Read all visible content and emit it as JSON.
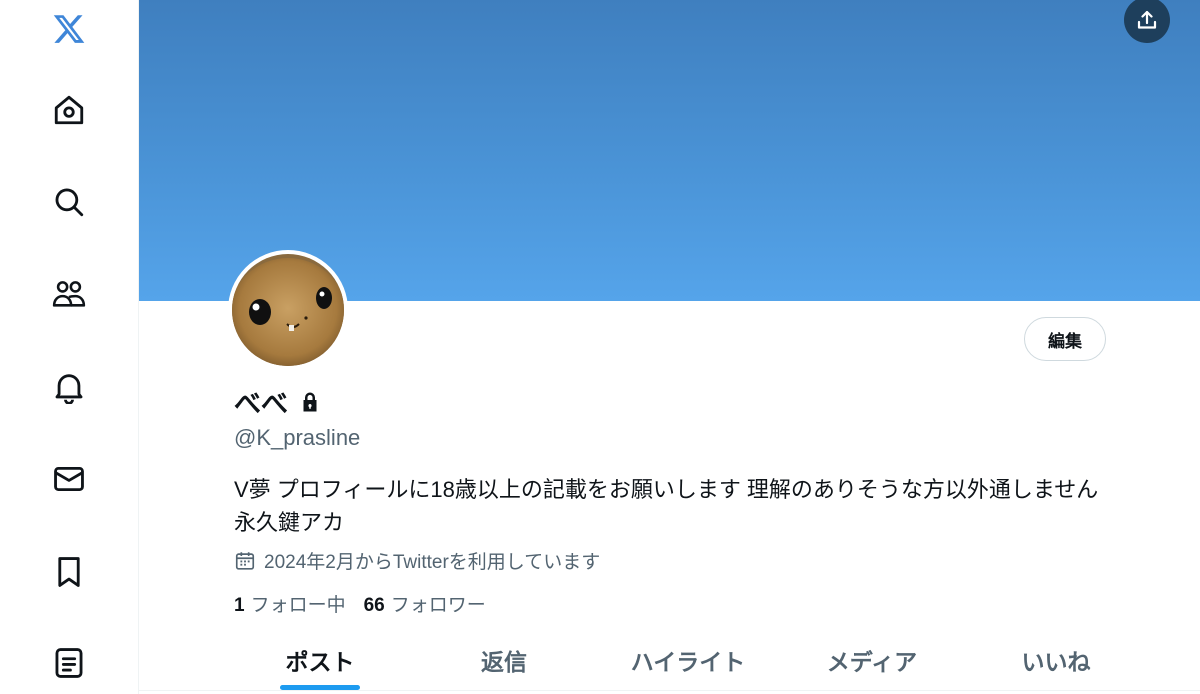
{
  "sidebar": {
    "items": [
      {
        "name": "x-logo",
        "icon": "x-logo-icon"
      },
      {
        "name": "home",
        "icon": "home-icon"
      },
      {
        "name": "explore",
        "icon": "search-icon"
      },
      {
        "name": "communities",
        "icon": "people-icon"
      },
      {
        "name": "notifications",
        "icon": "bell-icon"
      },
      {
        "name": "messages",
        "icon": "mail-icon"
      },
      {
        "name": "bookmarks",
        "icon": "bookmark-icon"
      },
      {
        "name": "lists",
        "icon": "list-icon"
      }
    ]
  },
  "header": {
    "share_icon": "upload-icon"
  },
  "profile": {
    "display_name": "べべ",
    "protected_icon": "lock-icon",
    "handle": "@K_prasline",
    "bio": "V夢 プロフィールに18歳以上の記載をお願いします 理解のありそうな方以外通しません 永久鍵アカ",
    "joined": "2024年2月からTwitterを利用しています",
    "following_count": "1",
    "following_label": "フォロー中",
    "followers_count": "66",
    "followers_label": "フォロワー",
    "edit_label": "編集"
  },
  "tabs": [
    {
      "label": "ポスト",
      "active": true
    },
    {
      "label": "返信",
      "active": false
    },
    {
      "label": "ハイライト",
      "active": false
    },
    {
      "label": "メディア",
      "active": false
    },
    {
      "label": "いいね",
      "active": false
    }
  ],
  "colors": {
    "banner": "#4a93d6",
    "accent": "#1d9bf0",
    "text": "#0f1419",
    "secondary_text": "#536471",
    "x_logo": "#3f86d8"
  }
}
